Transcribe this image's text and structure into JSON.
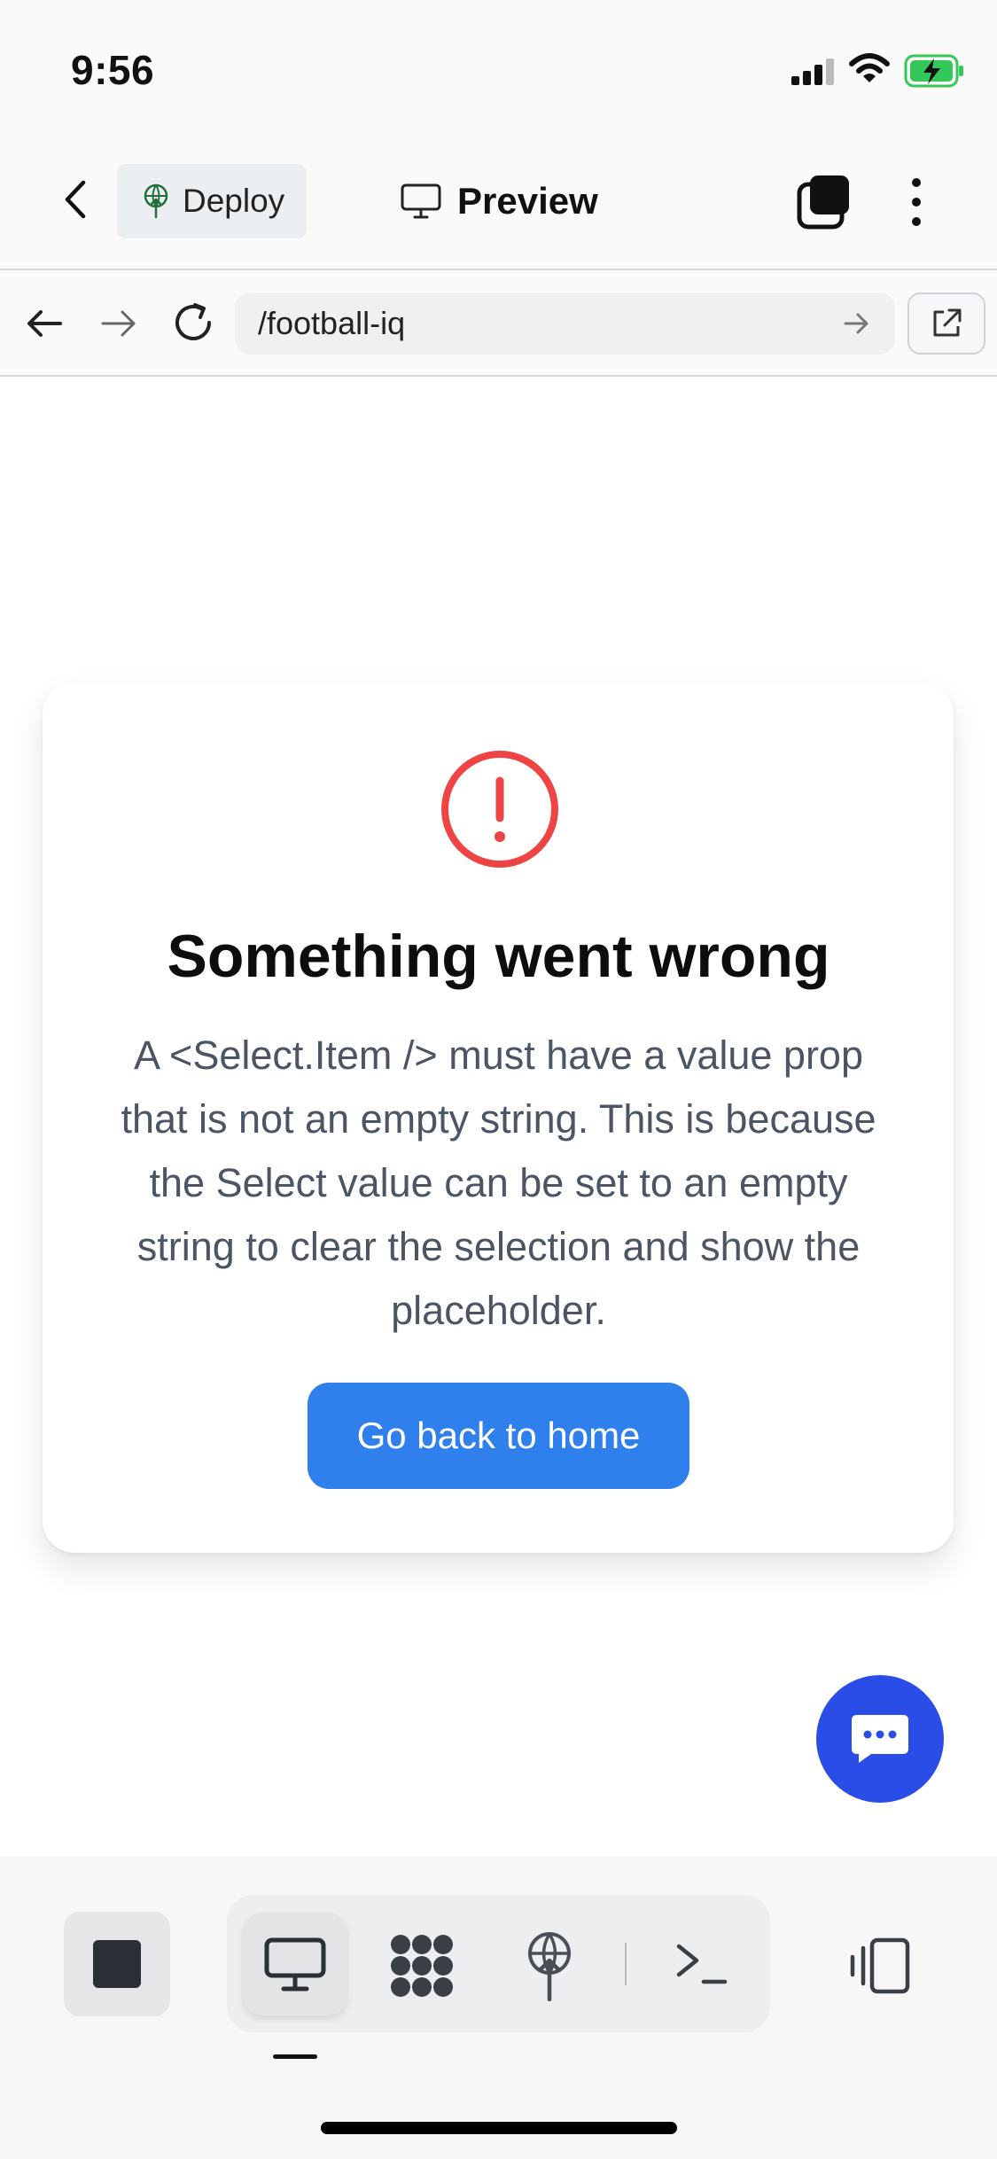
{
  "status_bar": {
    "time": "9:56"
  },
  "header": {
    "deploy_label": "Deploy",
    "preview_label": "Preview"
  },
  "url_bar": {
    "url": "/football-iq"
  },
  "error": {
    "title": "Something went wrong",
    "message": "A <Select.Item /> must have a value prop that is not an empty string. This is because the Select value can be set to an empty string to clear the selection and show the placeholder.",
    "button_label": "Go back to home"
  },
  "colors": {
    "accent_blue": "#2f80ed",
    "fab_blue": "#2a4de8",
    "error_red": "#ef4444",
    "battery_green": "#34c759"
  },
  "icons": [
    "signal-icon",
    "wifi-icon",
    "battery-charging-icon",
    "chevron-left-icon",
    "deploy-icon",
    "monitor-icon",
    "tabs-icon",
    "more-vertical-icon",
    "arrow-left-icon",
    "arrow-right-icon",
    "reload-icon",
    "go-arrow-icon",
    "external-link-icon",
    "alert-circle-icon",
    "chat-icon",
    "stop-icon",
    "desktop-icon",
    "apps-icon",
    "deploy-icon",
    "terminal-icon",
    "split-view-icon"
  ]
}
